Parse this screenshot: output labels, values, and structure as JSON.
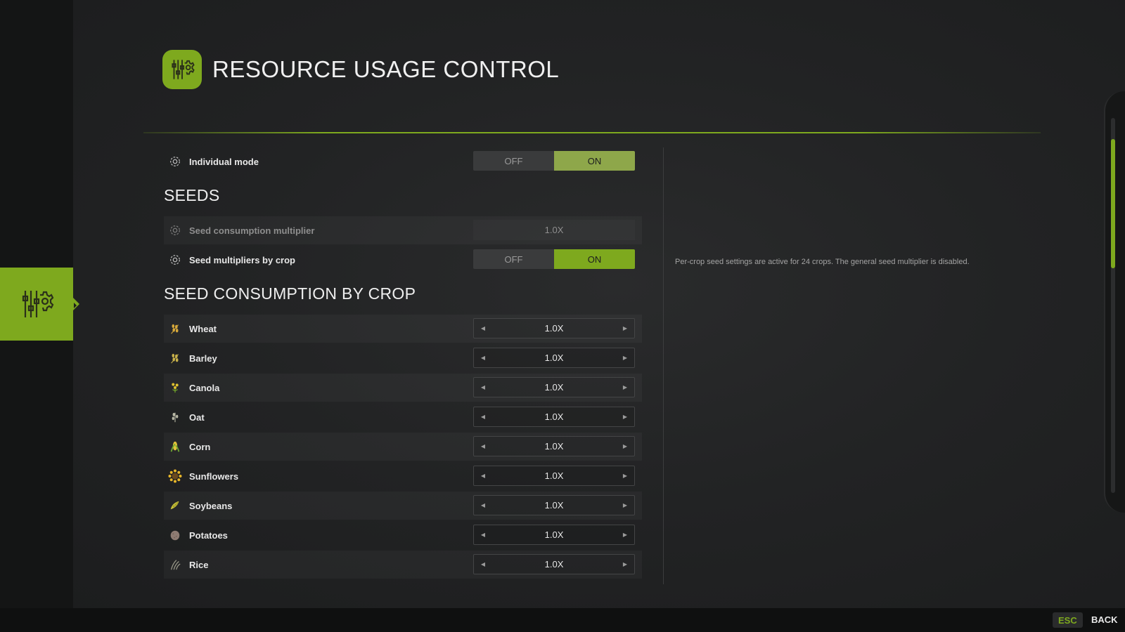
{
  "header": {
    "title": "RESOURCE USAGE CONTROL",
    "icon": "sliders-gear-icon"
  },
  "general": {
    "individual_mode": {
      "label": "Individual mode",
      "icon": "gear-icon",
      "off_label": "OFF",
      "on_label": "ON",
      "value": "ON"
    }
  },
  "seeds": {
    "heading": "SEEDS",
    "consumption_multiplier": {
      "label": "Seed consumption multiplier",
      "icon": "gear-icon",
      "value": "1.0X",
      "disabled": true
    },
    "multipliers_by_crop": {
      "label": "Seed multipliers by crop",
      "icon": "gear-icon",
      "off_label": "OFF",
      "on_label": "ON",
      "value": "ON"
    }
  },
  "by_crop": {
    "heading": "SEED CONSUMPTION BY CROP",
    "crops": [
      {
        "label": "Wheat",
        "value": "1.0X",
        "icon": "wheat-icon"
      },
      {
        "label": "Barley",
        "value": "1.0X",
        "icon": "barley-icon"
      },
      {
        "label": "Canola",
        "value": "1.0X",
        "icon": "canola-icon"
      },
      {
        "label": "Oat",
        "value": "1.0X",
        "icon": "oat-icon"
      },
      {
        "label": "Corn",
        "value": "1.0X",
        "icon": "corn-icon"
      },
      {
        "label": "Sunflowers",
        "value": "1.0X",
        "icon": "sunflower-icon"
      },
      {
        "label": "Soybeans",
        "value": "1.0X",
        "icon": "soybean-icon"
      },
      {
        "label": "Potatoes",
        "value": "1.0X",
        "icon": "potato-icon"
      },
      {
        "label": "Rice",
        "value": "1.0X",
        "icon": "rice-icon"
      }
    ]
  },
  "info_panel": {
    "text": "Per-crop seed settings are active for 24 crops. The general seed multiplier is disabled."
  },
  "footer": {
    "esc_key": "ESC",
    "back_label": "BACK"
  },
  "colors": {
    "accent": "#7ea91e",
    "background": "#1d1e1f",
    "sidebar": "#141515"
  }
}
